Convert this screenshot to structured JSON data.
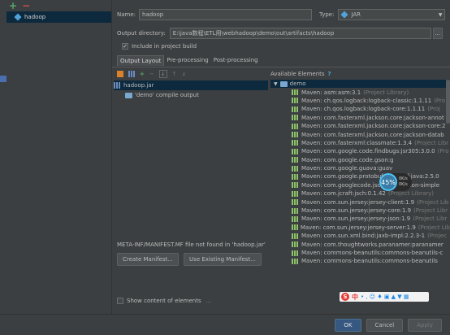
{
  "sidebar": {
    "artifact_name": "hadoop"
  },
  "header": {
    "name_label": "Name:",
    "name_value": "hadoop",
    "type_label": "Type:",
    "type_value": "JAR",
    "output_dir_label": "Output directory:",
    "output_dir_value": "E:\\java数程\\ETL用\\webhadoop\\demo\\out\\artifacts\\hadoop",
    "browse_label": "...",
    "include_build_label": "Include in project build",
    "include_build_checked": true
  },
  "tabs": [
    "Output Layout",
    "Pre-processing",
    "Post-processing"
  ],
  "output_layout": {
    "root": "hadoop.jar",
    "children": [
      "'demo' compile output"
    ]
  },
  "available": {
    "header": "Available Elements",
    "help": "?",
    "root": "demo",
    "items": [
      {
        "name": "Maven: asm:asm:3.1",
        "note": "(Project Library)"
      },
      {
        "name": "Maven: ch.qos.logback:logback-classic:1.1.11",
        "note": "(Pro"
      },
      {
        "name": "Maven: ch.qos.logback:logback-core:1.1.11",
        "note": "(Proj"
      },
      {
        "name": "Maven: com.fasterxml.jackson.core:jackson-annot",
        "note": ""
      },
      {
        "name": "Maven: com.fasterxml.jackson.core:jackson-core:2",
        "note": ""
      },
      {
        "name": "Maven: com.fasterxml.jackson.core:jackson-datab",
        "note": ""
      },
      {
        "name": "Maven: com.fasterxml:classmate:1.3.4",
        "note": "(Project Libr"
      },
      {
        "name": "Maven: com.google.code.findbugs:jsr305:3.0.0",
        "note": "(Pro"
      },
      {
        "name": "Maven: com.google.code.gson:g",
        "note": ""
      },
      {
        "name": "Maven: com.google.guava:guav",
        "note": ""
      },
      {
        "name": "Maven: com.google.protobuf:protobuf-java:2.5.0",
        "note": ""
      },
      {
        "name": "Maven: com.googlecode.json-simple:json-simple",
        "note": ""
      },
      {
        "name": "Maven: com.jcraft:jsch:0.1.42",
        "note": "(Project Library)"
      },
      {
        "name": "Maven: com.sun.jersey:jersey-client:1.9",
        "note": "(Project Lib"
      },
      {
        "name": "Maven: com.sun.jersey:jersey-core:1.9",
        "note": "(Project Libr"
      },
      {
        "name": "Maven: com.sun.jersey:jersey-json:1.9",
        "note": "(Project Libr"
      },
      {
        "name": "Maven: com.sun.jersey:jersey-server:1.9",
        "note": "(Project Lib"
      },
      {
        "name": "Maven: com.sun.xml.bind:jaxb-impl:2.2.3-1",
        "note": "(Projec"
      },
      {
        "name": "Maven: com.thoughtworks.paranamer:paranamer",
        "note": ""
      },
      {
        "name": "Maven: commons-beanutils:commons-beanutils-c",
        "note": ""
      },
      {
        "name": "Maven: commons-beanutils:commons-beanutils",
        "note": ""
      }
    ]
  },
  "manifest": {
    "message": "META-INF/MANIFEST.MF file not found in 'hadoop.jar'",
    "create_label": "Create Manifest...",
    "use_existing_label": "Use Existing Manifest..."
  },
  "show_content": {
    "label": "Show content of elements",
    "more": "..."
  },
  "progress": {
    "percent_text": "45%",
    "percent": 45,
    "speed_up": "0K/s",
    "speed_down": "0K/s"
  },
  "ime": {
    "logo": "S",
    "text": "中",
    "glyphs": "• , ☺ ♦ ▣ ▲ ▼ ▦"
  },
  "footer": {
    "ok": "OK",
    "cancel": "Cancel",
    "apply": "Apply"
  },
  "colors": {
    "background": "#3c3f41",
    "selection": "#0d293e",
    "accent_blue": "#365880",
    "add_green": "#59a869",
    "remove_red": "#c75450"
  }
}
